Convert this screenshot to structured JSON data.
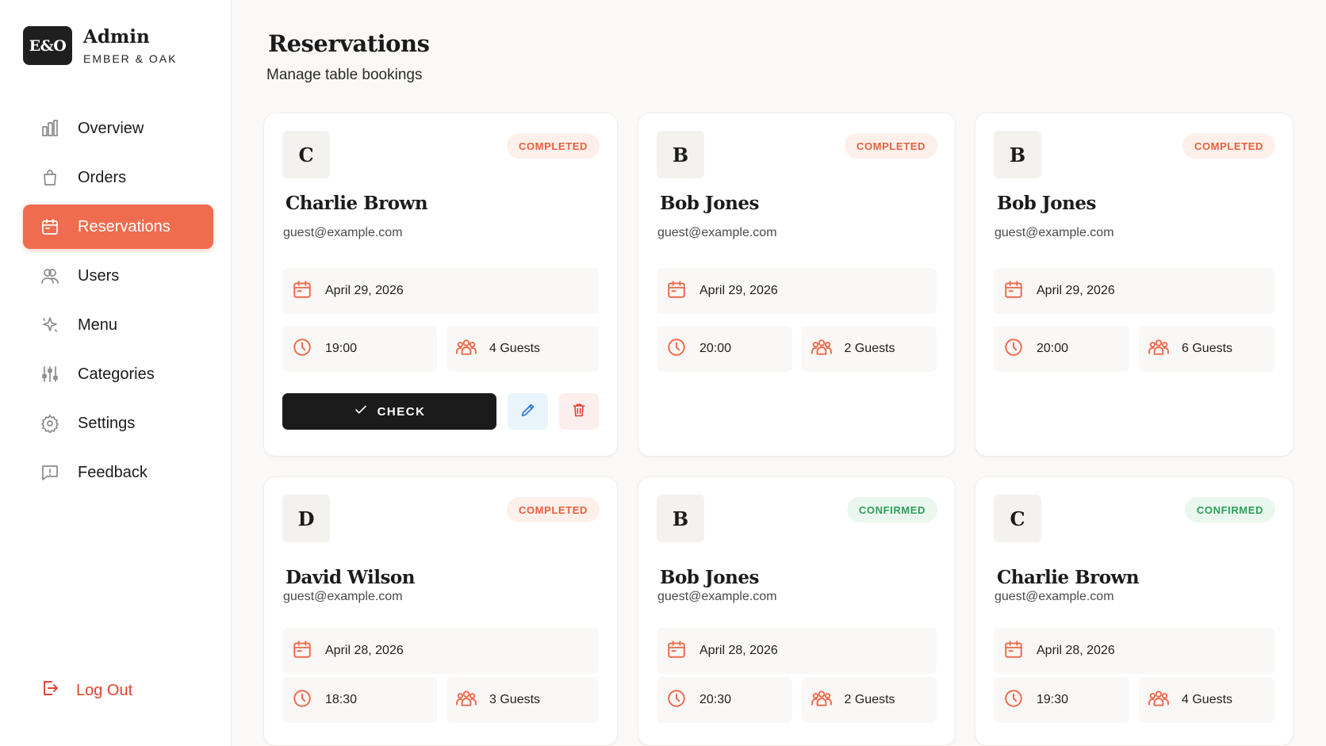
{
  "brand": {
    "logo": "E&O",
    "title": "Admin",
    "subtitle": "EMBER & OAK"
  },
  "sidebar": {
    "items": [
      {
        "label": "Overview",
        "icon": "chart-bar-icon"
      },
      {
        "label": "Orders",
        "icon": "shopping-bag-icon"
      },
      {
        "label": "Reservations",
        "icon": "calendar-icon",
        "active": true
      },
      {
        "label": "Users",
        "icon": "users-icon"
      },
      {
        "label": "Menu",
        "icon": "sparkles-icon"
      },
      {
        "label": "Categories",
        "icon": "sliders-icon"
      },
      {
        "label": "Settings",
        "icon": "gear-icon"
      },
      {
        "label": "Feedback",
        "icon": "feedback-icon"
      }
    ],
    "logout": "Log Out"
  },
  "header": {
    "title": "Reservations",
    "subtitle": "Manage table bookings"
  },
  "actions": {
    "check_label": "CHECK"
  },
  "colors": {
    "accent": "#f06c4f",
    "completed": "#e8603f",
    "confirmed": "#2f9d5a"
  },
  "reservations": [
    {
      "initial": "C",
      "name": "Charlie Brown",
      "email": "guest@example.com",
      "status": "COMPLETED",
      "date": "April 29, 2026",
      "time": "19:00",
      "guests": "4 Guests"
    },
    {
      "initial": "B",
      "name": "Bob Jones",
      "email": "guest@example.com",
      "status": "COMPLETED",
      "date": "April 29, 2026",
      "time": "20:00",
      "guests": "2 Guests"
    },
    {
      "initial": "B",
      "name": "Bob Jones",
      "email": "guest@example.com",
      "status": "COMPLETED",
      "date": "April 29, 2026",
      "time": "20:00",
      "guests": "6 Guests"
    },
    {
      "initial": "D",
      "name": "David Wilson",
      "email": "guest@example.com",
      "status": "COMPLETED",
      "date": "April 28, 2026",
      "time": "18:30",
      "guests": "3 Guests"
    },
    {
      "initial": "B",
      "name": "Bob Jones",
      "email": "guest@example.com",
      "status": "CONFIRMED",
      "date": "April 28, 2026",
      "time": "20:30",
      "guests": "2 Guests"
    },
    {
      "initial": "C",
      "name": "Charlie Brown",
      "email": "guest@example.com",
      "status": "CONFIRMED",
      "date": "April 28, 2026",
      "time": "19:30",
      "guests": "4 Guests"
    }
  ]
}
